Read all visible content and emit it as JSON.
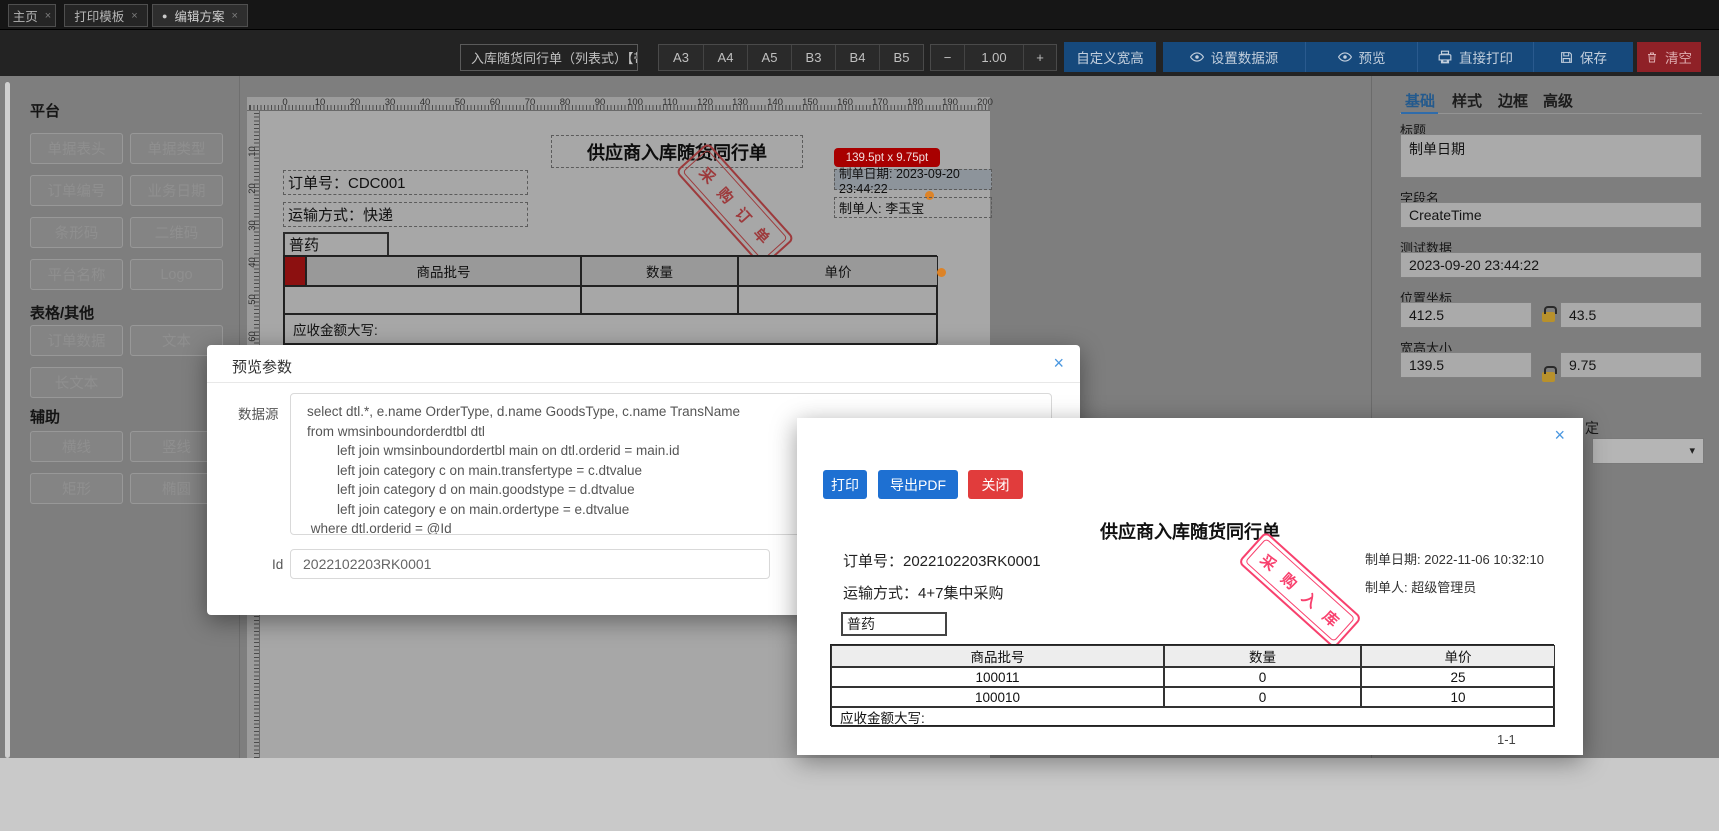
{
  "icons": {
    "close": "×",
    "dot": "●",
    "minus": "−",
    "plus": "+",
    "caret": "▾"
  },
  "tabs": [
    {
      "label": "主页"
    },
    {
      "label": "打印模板"
    },
    {
      "label": "编辑方案",
      "active": true
    }
  ],
  "toolbar": {
    "template_name": "入库随货同行单（列表式）【带",
    "sizes": [
      "A3",
      "A4",
      "A5",
      "B3",
      "B4",
      "B5"
    ],
    "zoom_value": "1.00",
    "custom_size": "自定义宽高",
    "set_datasource": "设置数据源",
    "preview": "预览",
    "direct_print": "直接打印",
    "save": "保存",
    "clear": "清空"
  },
  "sidebar": {
    "sections": [
      {
        "title": "平台",
        "items": [
          "单据表头",
          "单据类型",
          "订单编号",
          "业务日期",
          "条形码",
          "二维码",
          "平台名称",
          "Logo"
        ]
      },
      {
        "title": "表格/其他",
        "items": [
          "订单数据",
          "文本",
          "长文本"
        ]
      },
      {
        "title": "辅助",
        "items": [
          "横线",
          "竖线",
          "矩形",
          "椭圆"
        ]
      }
    ]
  },
  "canvas": {
    "ruler_h": [
      "0",
      "10",
      "20",
      "30",
      "40",
      "50",
      "60",
      "70",
      "80",
      "90",
      "100",
      "110",
      "120",
      "130",
      "140",
      "150",
      "160",
      "170",
      "180",
      "190",
      "200"
    ],
    "ruler_v": [
      "10",
      "20",
      "30",
      "40",
      "50",
      "60"
    ],
    "doc": {
      "title": "供应商入库随货同行单",
      "order_no": "订单号：CDC001",
      "transport": "运输方式：快递",
      "drug_type": "普药",
      "size_tooltip": "139.5pt x 9.75pt",
      "create_date": "制单日期: 2023-09-20 23:44:22",
      "creator": "制单人: 李玉宝",
      "stamp": "采购订单",
      "table": {
        "headers": [
          "商品批号",
          "数量",
          "单价"
        ],
        "footer": "应收金额大写:"
      }
    }
  },
  "panel": {
    "tabs": [
      "基础",
      "样式",
      "边框",
      "高级"
    ],
    "title_field": {
      "label": "标题",
      "value": "制单日期"
    },
    "field_name": {
      "label": "字段名",
      "value": "CreateTime"
    },
    "test_data": {
      "label": "测试数据",
      "value": "2023-09-20 23:44:22"
    },
    "position": {
      "label": "位置坐标",
      "x": "412.5",
      "y": "43.5"
    },
    "size": {
      "label": "宽高大小",
      "w": "139.5",
      "h": "9.75"
    },
    "partial_label": "定"
  },
  "preview_params_modal": {
    "title": "预览参数",
    "datasource_label": "数据源",
    "sql_lines": [
      "select dtl.*, e.name OrderType, d.name GoodsType, c.name TransName",
      "from wmsinboundorderdtbl dtl",
      "        left join wmsinboundordertbl main on dtl.orderid = main.id",
      "        left join category c on main.transfertype = c.dtvalue",
      "        left join category d on main.goodstype = d.dtvalue",
      "        left join category e on main.ordertype = e.dtvalue",
      " where dtl.orderid = @Id"
    ],
    "id_label": "Id",
    "id_value": "2022102203RK0001"
  },
  "preview_modal": {
    "buttons": [
      "打印",
      "导出PDF",
      "关闭"
    ],
    "title": "供应商入库随货同行单",
    "order_no": "订单号：2022102203RK0001",
    "transport": "运输方式：4+7集中采购",
    "drug_type": "普药",
    "create_date": "制单日期: 2022-11-06 10:32:10",
    "creator": "制单人: 超级管理员",
    "stamp": "采购入库",
    "table": {
      "headers": [
        "商品批号",
        "数量",
        "单价"
      ],
      "rows": [
        [
          "100011",
          "0",
          "25"
        ],
        [
          "100010",
          "0",
          "10"
        ]
      ],
      "footer": "应收金额大写:"
    },
    "page": "1-1"
  },
  "colors": {
    "toolbar_blue": "#16497c",
    "toolbar_red": "#8f2127",
    "modal_btn_blue": "#1e70d2",
    "modal_btn_red": "#e13c3c",
    "stamp_canvas": "#9d3a3c",
    "stamp_preview": "#f8416e",
    "tooltip_red": "#a80000",
    "tab_active_blue": "#245a8d"
  }
}
